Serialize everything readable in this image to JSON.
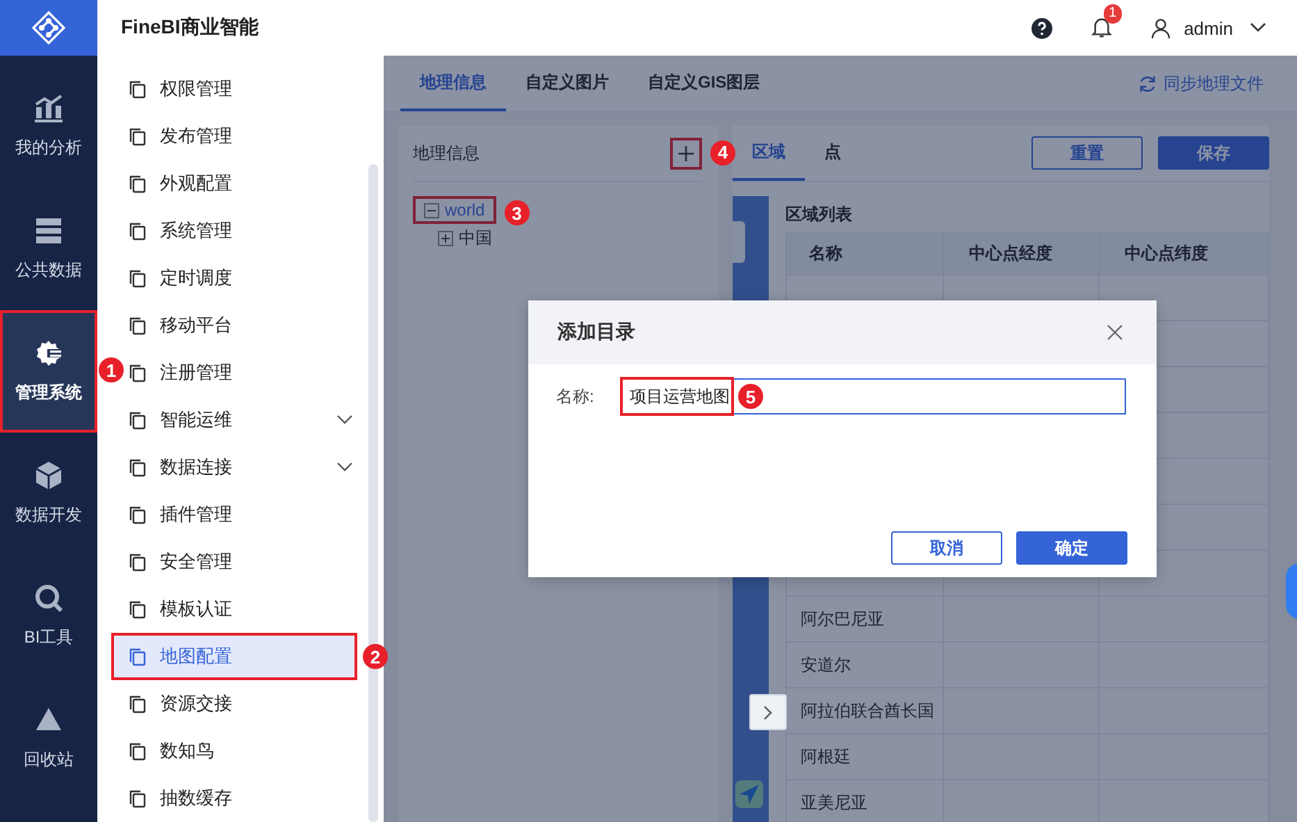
{
  "header": {
    "title": "FineBI商业智能",
    "notification_count": "1",
    "user": "admin"
  },
  "nav": [
    {
      "label": "我的分析",
      "selected": false
    },
    {
      "label": "公共数据",
      "selected": false
    },
    {
      "label": "管理系统",
      "selected": true,
      "marker": "1"
    },
    {
      "label": "数据开发",
      "selected": false
    },
    {
      "label": "BI工具",
      "selected": false
    },
    {
      "label": "回收站",
      "selected": false
    }
  ],
  "menu": [
    {
      "label": "权限管理",
      "selected": false,
      "expandable": false
    },
    {
      "label": "发布管理",
      "selected": false,
      "expandable": false
    },
    {
      "label": "外观配置",
      "selected": false,
      "expandable": false
    },
    {
      "label": "系统管理",
      "selected": false,
      "expandable": false
    },
    {
      "label": "定时调度",
      "selected": false,
      "expandable": false
    },
    {
      "label": "移动平台",
      "selected": false,
      "expandable": false
    },
    {
      "label": "注册管理",
      "selected": false,
      "expandable": false
    },
    {
      "label": "智能运维",
      "selected": false,
      "expandable": true
    },
    {
      "label": "数据连接",
      "selected": false,
      "expandable": true
    },
    {
      "label": "插件管理",
      "selected": false,
      "expandable": false
    },
    {
      "label": "安全管理",
      "selected": false,
      "expandable": false
    },
    {
      "label": "模板认证",
      "selected": false,
      "expandable": false
    },
    {
      "label": "地图配置",
      "selected": true,
      "expandable": false,
      "marker": "2"
    },
    {
      "label": "资源交接",
      "selected": false,
      "expandable": false
    },
    {
      "label": "数知鸟",
      "selected": false,
      "expandable": false
    },
    {
      "label": "抽数缓存",
      "selected": false,
      "expandable": false
    }
  ],
  "main": {
    "tabs": [
      {
        "label": "地理信息",
        "selected": true
      },
      {
        "label": "自定义图片",
        "selected": false
      },
      {
        "label": "自定义GIS图层",
        "selected": false
      }
    ],
    "sync_action": "同步地理文件",
    "geo_panel": {
      "title": "地理信息",
      "add_marker": "4",
      "tree": [
        {
          "label": "world",
          "expanded": true,
          "selected": true,
          "marker": "3",
          "children": [
            {
              "label": "中国",
              "expanded": false,
              "selected": false
            }
          ]
        }
      ]
    },
    "region_panel": {
      "tabs": [
        {
          "label": "区域",
          "selected": true
        },
        {
          "label": "点",
          "selected": false
        }
      ],
      "buttons": [
        {
          "label": "重置",
          "kind": "secondary"
        },
        {
          "label": "保存",
          "kind": "primary"
        }
      ],
      "list_title": "区域列表",
      "columns": [
        "名称",
        "中心点经度",
        "中心点纬度"
      ],
      "rows": [
        {
          "name": "阿尔巴尼亚"
        },
        {
          "name": "安道尔"
        },
        {
          "name": "阿拉伯联合酋长国"
        },
        {
          "name": "阿根廷"
        },
        {
          "name": "亚美尼亚"
        }
      ]
    }
  },
  "dialog": {
    "title": "添加目录",
    "field_label": "名称:",
    "value": "项目运营地图",
    "marker": "5",
    "buttons": [
      {
        "label": "取消",
        "kind": "secondary"
      },
      {
        "label": "确定",
        "kind": "primary"
      }
    ]
  }
}
